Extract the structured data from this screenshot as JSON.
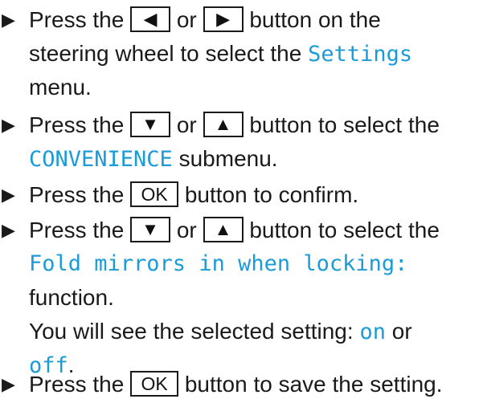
{
  "colors": {
    "accent": "#1b9bd7",
    "text": "#1a1a1a"
  },
  "bullet_glyph": "▶",
  "steps": [
    {
      "l1_pre": "Press the",
      "btn_a": "◀",
      "l1_mid": "or",
      "btn_b": "▶",
      "l1_post": "button on the",
      "l2_pre": "steering wheel to select the",
      "l2_mono": "Settings",
      "l3": "menu."
    },
    {
      "l1_pre": "Press the",
      "btn_a": "▼",
      "l1_mid": "or",
      "btn_b": "▲",
      "l1_post": "button to select the",
      "l2_mono": "CONVENIENCE",
      "l2_post": "submenu."
    },
    {
      "l1_pre": "Press the",
      "btn": "OK",
      "l1_post": "button to confirm."
    },
    {
      "l1_pre": "Press the",
      "btn_a": "▼",
      "l1_mid": "or",
      "btn_b": "▲",
      "l1_post": "button to select the",
      "l2_mono": "Fold mirrors in when locking:",
      "l3": "function.",
      "l4": "You will see the selected setting:",
      "on": "on",
      "or": "or",
      "off": "off",
      "period": "."
    },
    {
      "l1_pre": "Press the",
      "btn": "OK",
      "l1_post": "button to save the setting."
    }
  ]
}
